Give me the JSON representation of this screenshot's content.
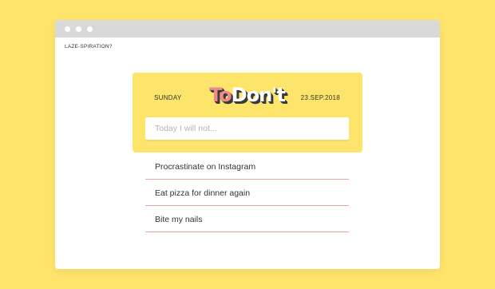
{
  "window": {
    "controls": [
      "close",
      "minimize",
      "maximize"
    ],
    "page_label": "LAZE-SPIRATION?"
  },
  "header": {
    "day": "SUNDAY",
    "date": "23.SEP.2018",
    "logo": {
      "part1": "To",
      "part2": "Don't"
    }
  },
  "input": {
    "placeholder": "Today I will not...",
    "value": ""
  },
  "items": [
    {
      "label": "Procrastinate on Instagram"
    },
    {
      "label": "Eat pizza for dinner again"
    },
    {
      "label": "Bite my nails"
    }
  ],
  "colors": {
    "background": "#ffe46b",
    "card": "#fde46b",
    "divider": "#f0a3a3",
    "logo_accent": "#f08a8a"
  }
}
